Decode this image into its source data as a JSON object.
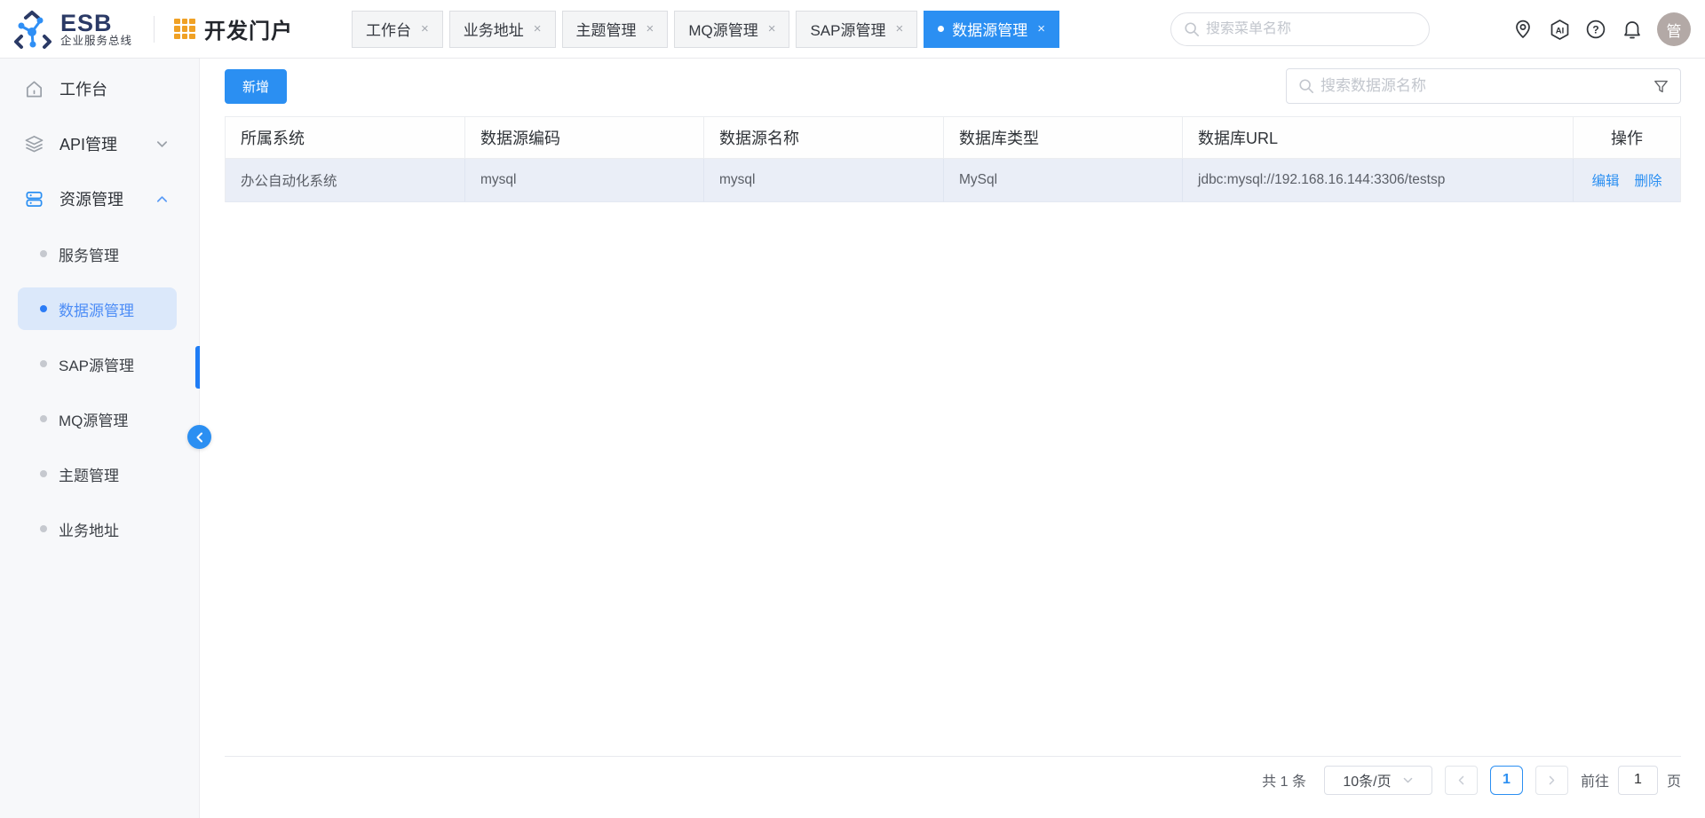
{
  "brand": {
    "name": "ESB",
    "subtitle": "企业服务总线",
    "portal": "开发门户"
  },
  "glyphs": {
    "close": "×",
    "ai": "AI",
    "question": "?"
  },
  "header": {
    "search_placeholder": "搜索菜单名称",
    "avatar_text": "管"
  },
  "tabs": [
    {
      "label": "工作台",
      "active": false
    },
    {
      "label": "业务地址",
      "active": false
    },
    {
      "label": "主题管理",
      "active": false
    },
    {
      "label": "MQ源管理",
      "active": false
    },
    {
      "label": "SAP源管理",
      "active": false
    },
    {
      "label": "数据源管理",
      "active": true
    }
  ],
  "sidebar": {
    "items": [
      {
        "label": "工作台",
        "icon": "home-icon"
      },
      {
        "label": "API管理",
        "icon": "layers-icon",
        "chevron": "down"
      },
      {
        "label": "资源管理",
        "icon": "stack-icon",
        "chevron": "up",
        "expanded": true
      }
    ],
    "subitems": [
      {
        "label": "服务管理",
        "active": false
      },
      {
        "label": "数据源管理",
        "active": true
      },
      {
        "label": "SAP源管理",
        "active": false
      },
      {
        "label": "MQ源管理",
        "active": false
      },
      {
        "label": "主题管理",
        "active": false
      },
      {
        "label": "业务地址",
        "active": false
      }
    ]
  },
  "toolbar": {
    "add_label": "新增",
    "search_placeholder": "搜索数据源名称"
  },
  "table": {
    "columns": [
      "所属系统",
      "数据源编码",
      "数据源名称",
      "数据库类型",
      "数据库URL",
      "操作"
    ],
    "rows": [
      {
        "system": "办公自动化系统",
        "code": "mysql",
        "name": "mysql",
        "db_type": "MySql",
        "url": "jdbc:mysql://192.168.16.144:3306/testsp",
        "edit_label": "编辑",
        "delete_label": "删除"
      }
    ]
  },
  "pagination": {
    "total": "共 1 条",
    "page_size": "10条/页",
    "current_page": "1",
    "goto_label": "前往",
    "goto_value": "1",
    "unit_label": "页"
  },
  "colors": {
    "primary": "#2b8ff2",
    "navy": "#2b3a66",
    "orange": "#f0a125",
    "row_highlight": "#eaeef7",
    "sidebar_active_bg": "#dbe8fa"
  }
}
